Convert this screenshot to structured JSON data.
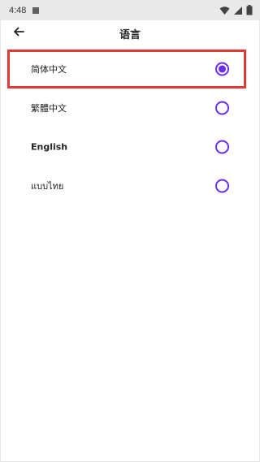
{
  "status_bar": {
    "time": "4:48",
    "icons": [
      "wifi-icon",
      "signal-icon",
      "battery-icon"
    ]
  },
  "toolbar": {
    "back_icon": "arrow-left-icon",
    "title": "语言"
  },
  "languages": [
    {
      "label": "简体中文",
      "selected": true
    },
    {
      "label": "繁體中文",
      "selected": false
    },
    {
      "label": "English",
      "selected": false
    },
    {
      "label": "แบบไทย",
      "selected": false
    }
  ],
  "colors": {
    "accent": "#6b2cf5",
    "highlight": "#e53935",
    "status_bar_bg": "#e9e9e9"
  }
}
